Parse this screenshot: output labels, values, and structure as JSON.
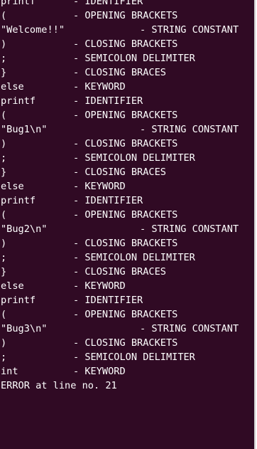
{
  "terminal": {
    "background": "#300a24",
    "foreground": "#ffffff",
    "lines": [
      {
        "token": "printf",
        "desc": "- IDENTIFIER",
        "kind": "std"
      },
      {
        "token": "(",
        "desc": "- OPENING BRACKETS",
        "kind": "std"
      },
      {
        "token": "\"Welcome!!\"",
        "desc": "- STRING CONSTANT",
        "kind": "str"
      },
      {
        "token": ")",
        "desc": "- CLOSING BRACKETS",
        "kind": "std"
      },
      {
        "token": ";",
        "desc": "- SEMICOLON DELIMITER",
        "kind": "std"
      },
      {
        "token": "}",
        "desc": "- CLOSING BRACES",
        "kind": "std"
      },
      {
        "token": "else",
        "desc": "- KEYWORD",
        "kind": "std"
      },
      {
        "token": "printf",
        "desc": "- IDENTIFIER",
        "kind": "std"
      },
      {
        "token": "(",
        "desc": "- OPENING BRACKETS",
        "kind": "std"
      },
      {
        "token": "\"Bug1\\n\"",
        "desc": "- STRING CONSTANT",
        "kind": "str"
      },
      {
        "token": ")",
        "desc": "- CLOSING BRACKETS",
        "kind": "std"
      },
      {
        "token": ";",
        "desc": "- SEMICOLON DELIMITER",
        "kind": "std"
      },
      {
        "token": "}",
        "desc": "- CLOSING BRACES",
        "kind": "std"
      },
      {
        "token": "else",
        "desc": "- KEYWORD",
        "kind": "std"
      },
      {
        "token": "printf",
        "desc": "- IDENTIFIER",
        "kind": "std"
      },
      {
        "token": "(",
        "desc": "- OPENING BRACKETS",
        "kind": "std"
      },
      {
        "token": "\"Bug2\\n\"",
        "desc": "- STRING CONSTANT",
        "kind": "str"
      },
      {
        "token": ")",
        "desc": "- CLOSING BRACKETS",
        "kind": "std"
      },
      {
        "token": ";",
        "desc": "- SEMICOLON DELIMITER",
        "kind": "std"
      },
      {
        "token": "}",
        "desc": "- CLOSING BRACES",
        "kind": "std"
      },
      {
        "token": "else",
        "desc": "- KEYWORD",
        "kind": "std"
      },
      {
        "token": "printf",
        "desc": "- IDENTIFIER",
        "kind": "std"
      },
      {
        "token": "(",
        "desc": "- OPENING BRACKETS",
        "kind": "std"
      },
      {
        "token": "\"Bug3\\n\"",
        "desc": "- STRING CONSTANT",
        "kind": "str"
      },
      {
        "token": ")",
        "desc": "- CLOSING BRACKETS",
        "kind": "std"
      },
      {
        "token": ";",
        "desc": "- SEMICOLON DELIMITER",
        "kind": "std"
      },
      {
        "token": "int",
        "desc": "- KEYWORD",
        "kind": "std"
      }
    ],
    "error_line": "ERROR at line no. 21"
  }
}
